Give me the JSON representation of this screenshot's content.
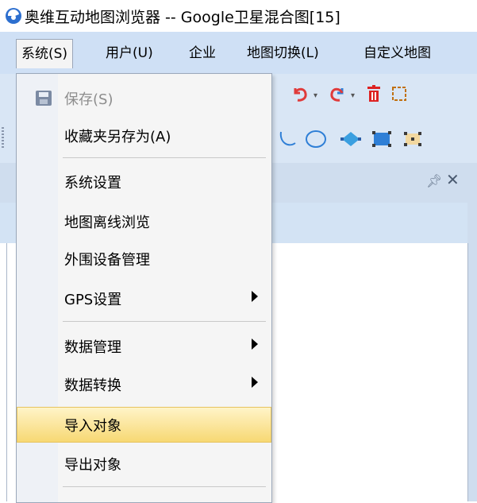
{
  "window": {
    "title": "奥维互动地图浏览器 -- Google卫星混合图[15]"
  },
  "menubar": {
    "items": [
      {
        "label": "系统(S)"
      },
      {
        "label": "用户(U)"
      },
      {
        "label": "企业"
      },
      {
        "label": "地图切换(L)"
      },
      {
        "label": "自定义地图"
      }
    ]
  },
  "dropdown": {
    "items": [
      {
        "label": "保存(S)",
        "disabled": true
      },
      {
        "label": "收藏夹另存为(A)"
      },
      {
        "label": "系统设置"
      },
      {
        "label": "地图离线浏览"
      },
      {
        "label": "外围设备管理"
      },
      {
        "label": "GPS设置",
        "submenu": true
      },
      {
        "label": "数据管理",
        "submenu": true
      },
      {
        "label": "数据转换",
        "submenu": true
      },
      {
        "label": "导入对象",
        "highlighted": true
      },
      {
        "label": "导出对象"
      }
    ]
  },
  "panel": {
    "pin_icon": "pin-icon",
    "close_icon": "close-icon"
  },
  "colors": {
    "menubar_bg": "#cfe0f5",
    "highlight": "#f7d873",
    "undo_red": "#e03b3b",
    "redo_blue": "#2f7fd6"
  }
}
